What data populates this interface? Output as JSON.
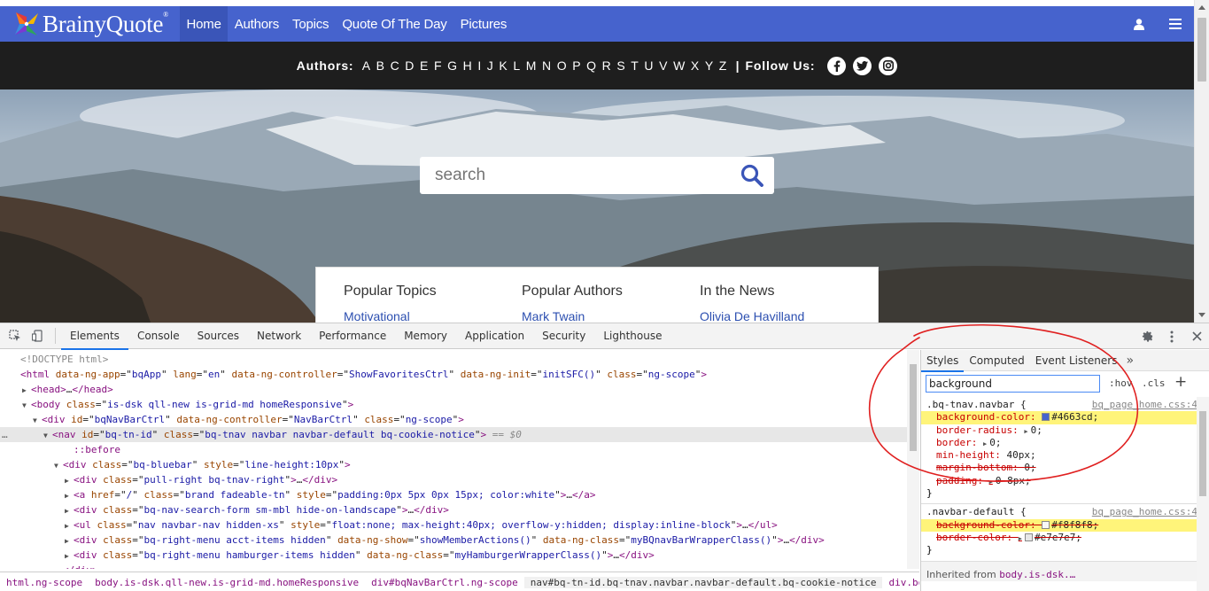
{
  "site": {
    "logo_text": "BrainyQuote",
    "logo_mark": "®",
    "nav": [
      {
        "label": "Home",
        "active": true
      },
      {
        "label": "Authors",
        "active": false
      },
      {
        "label": "Topics",
        "active": false
      },
      {
        "label": "Quote Of The Day",
        "active": false
      },
      {
        "label": "Pictures",
        "active": false
      }
    ],
    "brand_color": "#4663cd",
    "alphabar": {
      "label": "Authors:",
      "letters": [
        "A",
        "B",
        "C",
        "D",
        "E",
        "F",
        "G",
        "H",
        "I",
        "J",
        "K",
        "L",
        "M",
        "N",
        "O",
        "P",
        "Q",
        "R",
        "S",
        "T",
        "U",
        "V",
        "W",
        "X",
        "Y",
        "Z"
      ],
      "separator": "|",
      "follow_label": "Follow Us:",
      "social_icons": [
        "facebook-icon",
        "twitter-icon",
        "instagram-icon"
      ]
    },
    "search": {
      "placeholder": "search"
    },
    "popular": [
      {
        "heading": "Popular Topics",
        "first_link": "Motivational"
      },
      {
        "heading": "Popular Authors",
        "first_link": "Mark Twain"
      },
      {
        "heading": "In the News",
        "first_link": "Olivia De Havilland"
      }
    ]
  },
  "devtools": {
    "tabs": [
      "Elements",
      "Console",
      "Sources",
      "Network",
      "Performance",
      "Memory",
      "Application",
      "Security",
      "Lighthouse"
    ],
    "active_tab": "Elements",
    "elements": [
      {
        "indent": 0,
        "tri": "",
        "parts": [
          [
            "com",
            "<!DOCTYPE html>"
          ]
        ]
      },
      {
        "indent": 0,
        "tri": "",
        "parts": [
          [
            "tag",
            "<html "
          ],
          [
            "attr",
            "data-ng-app"
          ],
          [
            "plain",
            "=\""
          ],
          [
            "val",
            "bqApp"
          ],
          [
            "plain",
            "\" "
          ],
          [
            "attr",
            "lang"
          ],
          [
            "plain",
            "=\""
          ],
          [
            "val",
            "en"
          ],
          [
            "plain",
            "\" "
          ],
          [
            "attr",
            "data-ng-controller"
          ],
          [
            "plain",
            "=\""
          ],
          [
            "val",
            "ShowFavoritesCtrl"
          ],
          [
            "plain",
            "\" "
          ],
          [
            "attr",
            "data-ng-init"
          ],
          [
            "plain",
            "=\""
          ],
          [
            "val",
            "initSFC()"
          ],
          [
            "plain",
            "\" "
          ],
          [
            "attr",
            "class"
          ],
          [
            "plain",
            "=\""
          ],
          [
            "val",
            "ng-scope"
          ],
          [
            "plain",
            "\""
          ],
          [
            "tag",
            ">"
          ]
        ]
      },
      {
        "indent": 1,
        "tri": "▶",
        "parts": [
          [
            "tag",
            "<head>"
          ],
          [
            "plain",
            "…"
          ],
          [
            "tag",
            "</head>"
          ]
        ]
      },
      {
        "indent": 1,
        "tri": "▼",
        "parts": [
          [
            "tag",
            "<body "
          ],
          [
            "attr",
            "class"
          ],
          [
            "plain",
            "=\""
          ],
          [
            "val",
            "is-dsk qll-new is-grid-md homeResponsive"
          ],
          [
            "plain",
            "\""
          ],
          [
            "tag",
            ">"
          ]
        ]
      },
      {
        "indent": 2,
        "tri": "▼",
        "parts": [
          [
            "tag",
            "<div "
          ],
          [
            "attr",
            "id"
          ],
          [
            "plain",
            "=\""
          ],
          [
            "val",
            "bqNavBarCtrl"
          ],
          [
            "plain",
            "\" "
          ],
          [
            "attr",
            "data-ng-controller"
          ],
          [
            "plain",
            "=\""
          ],
          [
            "val",
            "NavBarCtrl"
          ],
          [
            "plain",
            "\" "
          ],
          [
            "attr",
            "class"
          ],
          [
            "plain",
            "=\""
          ],
          [
            "val",
            "ng-scope"
          ],
          [
            "plain",
            "\""
          ],
          [
            "tag",
            ">"
          ]
        ]
      },
      {
        "indent": 3,
        "tri": "▼",
        "selected": true,
        "parts": [
          [
            "tag",
            "<nav "
          ],
          [
            "attr",
            "id"
          ],
          [
            "plain",
            "=\""
          ],
          [
            "val",
            "bq-tn-id"
          ],
          [
            "plain",
            "\" "
          ],
          [
            "attr",
            "class"
          ],
          [
            "plain",
            "=\""
          ],
          [
            "val",
            "bq-tnav navbar navbar-default bq-cookie-notice"
          ],
          [
            "plain",
            "\""
          ],
          [
            "tag",
            ">"
          ],
          [
            "plain",
            " == $0"
          ]
        ]
      },
      {
        "indent": 5,
        "tri": "",
        "parts": [
          [
            "pseudo",
            "::before"
          ]
        ]
      },
      {
        "indent": 4,
        "tri": "▼",
        "parts": [
          [
            "tag",
            "<div "
          ],
          [
            "attr",
            "class"
          ],
          [
            "plain",
            "=\""
          ],
          [
            "val",
            "bq-bluebar"
          ],
          [
            "plain",
            "\" "
          ],
          [
            "attr",
            "style"
          ],
          [
            "plain",
            "=\""
          ],
          [
            "val",
            "line-height:10px"
          ],
          [
            "plain",
            "\""
          ],
          [
            "tag",
            ">"
          ]
        ]
      },
      {
        "indent": 5,
        "tri": "▶",
        "parts": [
          [
            "tag",
            "<div "
          ],
          [
            "attr",
            "class"
          ],
          [
            "plain",
            "=\""
          ],
          [
            "val",
            "pull-right bq-tnav-right"
          ],
          [
            "plain",
            "\""
          ],
          [
            "tag",
            ">"
          ],
          [
            "plain",
            "…"
          ],
          [
            "tag",
            "</div>"
          ]
        ]
      },
      {
        "indent": 5,
        "tri": "▶",
        "parts": [
          [
            "tag",
            "<a "
          ],
          [
            "attr",
            "href"
          ],
          [
            "plain",
            "=\""
          ],
          [
            "val",
            "/"
          ],
          [
            "plain",
            "\" "
          ],
          [
            "attr",
            "class"
          ],
          [
            "plain",
            "=\""
          ],
          [
            "val",
            "brand fadeable-tn"
          ],
          [
            "plain",
            "\" "
          ],
          [
            "attr",
            "style"
          ],
          [
            "plain",
            "=\""
          ],
          [
            "val",
            "padding:0px 5px 0px 15px; color:white"
          ],
          [
            "plain",
            "\""
          ],
          [
            "tag",
            ">"
          ],
          [
            "plain",
            "…"
          ],
          [
            "tag",
            "</a>"
          ]
        ]
      },
      {
        "indent": 5,
        "tri": "▶",
        "parts": [
          [
            "tag",
            "<div "
          ],
          [
            "attr",
            "class"
          ],
          [
            "plain",
            "=\""
          ],
          [
            "val",
            "bq-nav-search-form sm-mbl hide-on-landscape"
          ],
          [
            "plain",
            "\""
          ],
          [
            "tag",
            ">"
          ],
          [
            "plain",
            "…"
          ],
          [
            "tag",
            "</div>"
          ]
        ]
      },
      {
        "indent": 5,
        "tri": "▶",
        "parts": [
          [
            "tag",
            "<ul "
          ],
          [
            "attr",
            "class"
          ],
          [
            "plain",
            "=\""
          ],
          [
            "val",
            "nav navbar-nav hidden-xs"
          ],
          [
            "plain",
            "\" "
          ],
          [
            "attr",
            "style"
          ],
          [
            "plain",
            "=\""
          ],
          [
            "val",
            "float:none; max-height:40px; overflow-y:hidden; display:inline-block"
          ],
          [
            "plain",
            "\""
          ],
          [
            "tag",
            ">"
          ],
          [
            "plain",
            "…"
          ],
          [
            "tag",
            "</ul>"
          ]
        ]
      },
      {
        "indent": 5,
        "tri": "▶",
        "parts": [
          [
            "tag",
            "<div "
          ],
          [
            "attr",
            "class"
          ],
          [
            "plain",
            "=\""
          ],
          [
            "val",
            "bq-right-menu acct-items hidden"
          ],
          [
            "plain",
            "\" "
          ],
          [
            "attr",
            "data-ng-show"
          ],
          [
            "plain",
            "=\""
          ],
          [
            "val",
            "showMemberActions()"
          ],
          [
            "plain",
            "\" "
          ],
          [
            "attr",
            "data-ng-class"
          ],
          [
            "plain",
            "=\""
          ],
          [
            "val",
            "myBQnavBarWrapperClass()"
          ],
          [
            "plain",
            "\""
          ],
          [
            "tag",
            ">"
          ],
          [
            "plain",
            "…"
          ],
          [
            "tag",
            "</div>"
          ]
        ]
      },
      {
        "indent": 5,
        "tri": "▶",
        "parts": [
          [
            "tag",
            "<div "
          ],
          [
            "attr",
            "class"
          ],
          [
            "plain",
            "=\""
          ],
          [
            "val",
            "bq-right-menu hamburger-items hidden"
          ],
          [
            "plain",
            "\" "
          ],
          [
            "attr",
            "data-ng-class"
          ],
          [
            "plain",
            "=\""
          ],
          [
            "val",
            "myHamburgerWrapperClass()"
          ],
          [
            "plain",
            "\""
          ],
          [
            "tag",
            ">"
          ],
          [
            "plain",
            "…"
          ],
          [
            "tag",
            "</div>"
          ]
        ]
      },
      {
        "indent": 4,
        "tri": "",
        "parts": [
          [
            "tag",
            "</div>"
          ]
        ]
      }
    ],
    "breadcrumbs": [
      {
        "tag": "html",
        "cls": ".ng-scope"
      },
      {
        "tag": "body",
        "cls": ".is-dsk.qll-new.is-grid-md.homeResponsive"
      },
      {
        "tag": "div",
        "cls": "#bqNavBarCtrl.ng-scope"
      },
      {
        "tag": "nav",
        "cls": "#bq-tn-id.bq-tnav.navbar.navbar-default.bq-cookie-notice",
        "active": true
      },
      {
        "tag": "div",
        "cls": ".bq-bluebar"
      }
    ],
    "styles": {
      "tabs": [
        "Styles",
        "Computed",
        "Event Listeners"
      ],
      "more": "»",
      "filter_value": "background",
      "hov": ":hov",
      "cls": ".cls",
      "plus": "+",
      "rules": [
        {
          "selector": ".bq-tnav.navbar {",
          "source": "bq_page_home.css:4",
          "props": [
            {
              "name": "background-color",
              "value": "#4663cd",
              "swatch": "#4663cd",
              "highlight": true
            },
            {
              "name": "border-radius",
              "value": "0",
              "arrow": true
            },
            {
              "name": "border",
              "value": "0",
              "arrow": true
            },
            {
              "name": "min-height",
              "value": "40px"
            },
            {
              "name": "margin-bottom",
              "value": "0",
              "struck": true
            },
            {
              "name": "padding",
              "value": "0 8px",
              "arrow": true,
              "struck": true
            }
          ],
          "close": "}"
        },
        {
          "selector": ".navbar-default {",
          "source": "bq_page_home.css:4",
          "props": [
            {
              "name": "background-color",
              "value": "#f8f8f8",
              "swatch": "#f8f8f8",
              "highlight": true,
              "struck": true
            },
            {
              "name": "border-color",
              "value": "#e7e7e7",
              "swatch": "#e7e7e7",
              "arrow": true,
              "struck": true
            }
          ],
          "close": "}"
        }
      ],
      "inherited_label": "Inherited from",
      "inherited_tag": "body.is-dsk.…"
    }
  },
  "annotation_color": "#e02020"
}
